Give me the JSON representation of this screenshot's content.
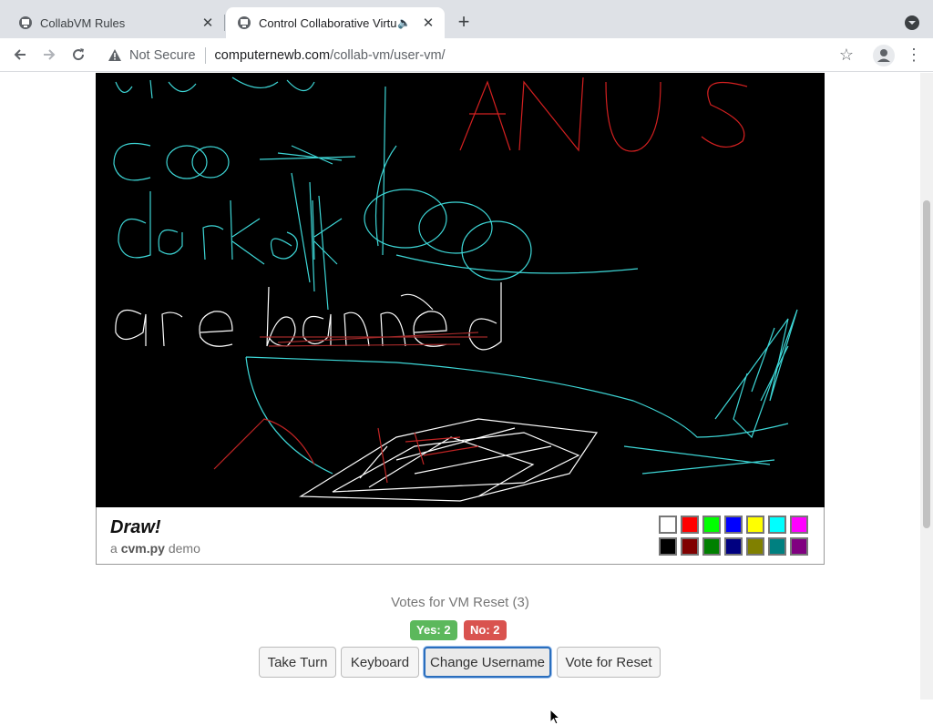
{
  "browser": {
    "tabs": [
      {
        "title": "CollabVM Rules",
        "active": false
      },
      {
        "title": "Control Collaborative Virtu",
        "active": true
      }
    ],
    "new_tab_label": "+",
    "security_label": "Not Secure",
    "url_host": "computernewb.com",
    "url_path": "/collab-vm/user-vm/"
  },
  "draw_app": {
    "title": "Draw!",
    "subtitle_prefix": "a",
    "subtitle_brand": "cvm.py",
    "subtitle_suffix": "demo",
    "palette": [
      "#ffffff",
      "#ff0000",
      "#00ff00",
      "#0000ff",
      "#ffff00",
      "#00ffff",
      "#ff00ff",
      "#000000",
      "#800000",
      "#008000",
      "#000080",
      "#808000",
      "#008080",
      "#800080"
    ]
  },
  "vote": {
    "title": "Votes for VM Reset (3)",
    "yes_label": "Yes: 2",
    "no_label": "No: 2"
  },
  "actions": {
    "take_turn": "Take Turn",
    "keyboard": "Keyboard",
    "change_username": "Change Username",
    "vote_reset": "Vote for Reset"
  },
  "colors": {
    "yes": "#5cb85c",
    "no": "#d9534f",
    "focus": "#2a6ebd"
  }
}
